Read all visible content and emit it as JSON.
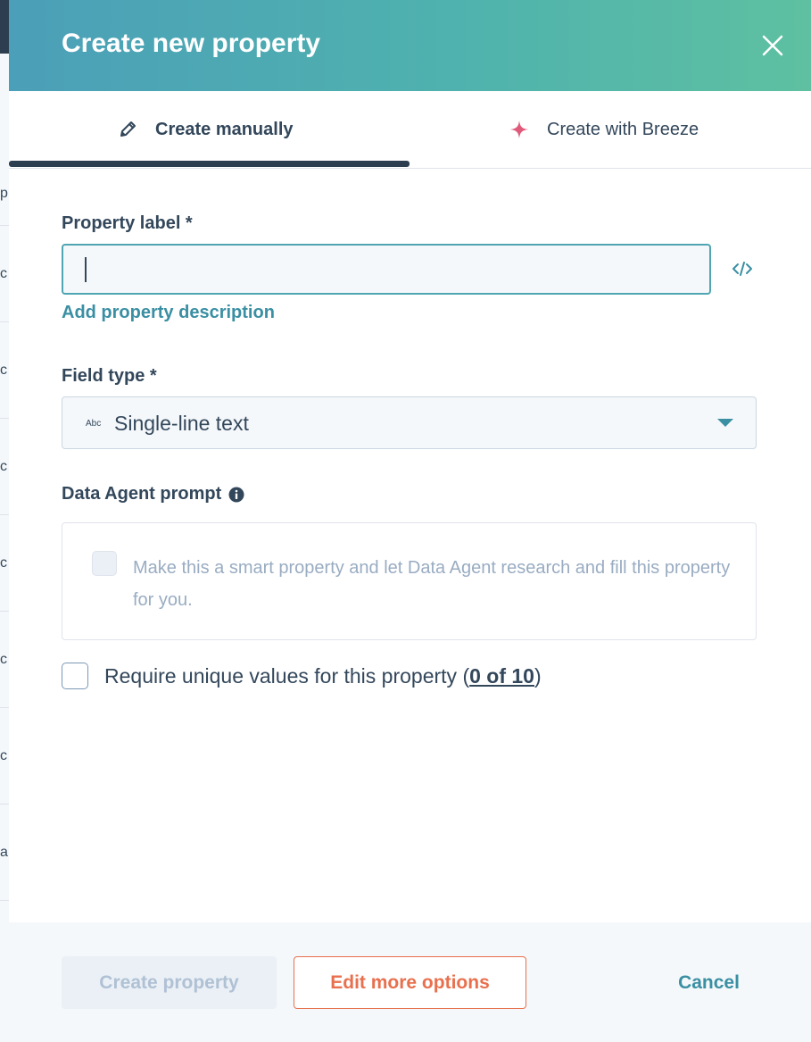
{
  "background": {
    "left_letters": [
      "p",
      "c",
      "c",
      "c",
      "c",
      "c",
      "c",
      "a"
    ]
  },
  "header": {
    "title": "Create new property",
    "close_icon": "close-icon",
    "gradient_start": "#4b9fb8",
    "gradient_end": "#5ec0a0"
  },
  "tabs": {
    "manual": {
      "label": "Create manually",
      "icon": "pencil-icon",
      "active": true
    },
    "breeze": {
      "label": "Create with Breeze",
      "icon": "sparkle-icon",
      "active": false
    }
  },
  "form": {
    "property_label": {
      "label": "Property label *",
      "value": ""
    },
    "add_description": "Add property description",
    "field_type": {
      "label": "Field type *",
      "badge": "Abc",
      "value": "Single-line text"
    },
    "data_agent": {
      "label": "Data Agent prompt",
      "checkbox_text": "Make this a smart property and let Data Agent research and fill this property for you."
    },
    "unique": {
      "text_before": "Require unique values for this property (",
      "link": "0 of 10",
      "text_after": ")"
    }
  },
  "footer": {
    "create_label": "Create property",
    "edit_label": "Edit more options",
    "cancel_label": "Cancel"
  },
  "colors": {
    "accent_teal": "#3a8fa3",
    "orange": "#e8704e",
    "text_dark": "#33475b",
    "muted": "#99acc2"
  }
}
